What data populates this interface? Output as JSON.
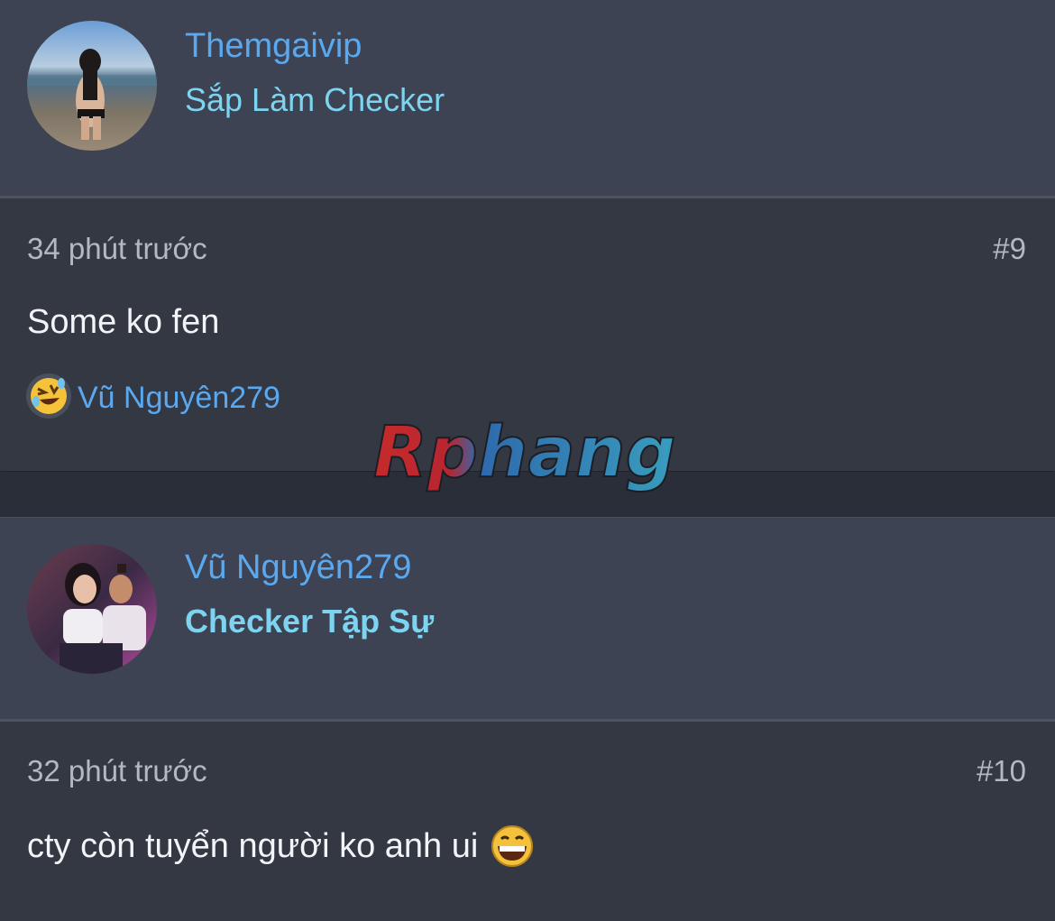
{
  "posts": [
    {
      "username": "Themgaivip",
      "user_title": "Sắp Làm Checker",
      "time": "34 phút trước",
      "number": "#9",
      "content": "Some ko fen",
      "reaction": {
        "icon": "rolling-laughing-emoji-icon",
        "user": "Vũ Nguyên279"
      }
    },
    {
      "username": "Vũ Nguyên279",
      "user_title": "Checker Tập Sự",
      "time": "32 phút trước",
      "number": "#10",
      "content": "cty còn tuyển người ko anh ui",
      "emoji": "grinning-emoji-icon"
    }
  ],
  "watermark": "Rphang",
  "colors": {
    "username": "#5aa9f0",
    "user_title": "#7dd4f0",
    "header_bg": "#3d4352",
    "body_bg": "#343843"
  }
}
